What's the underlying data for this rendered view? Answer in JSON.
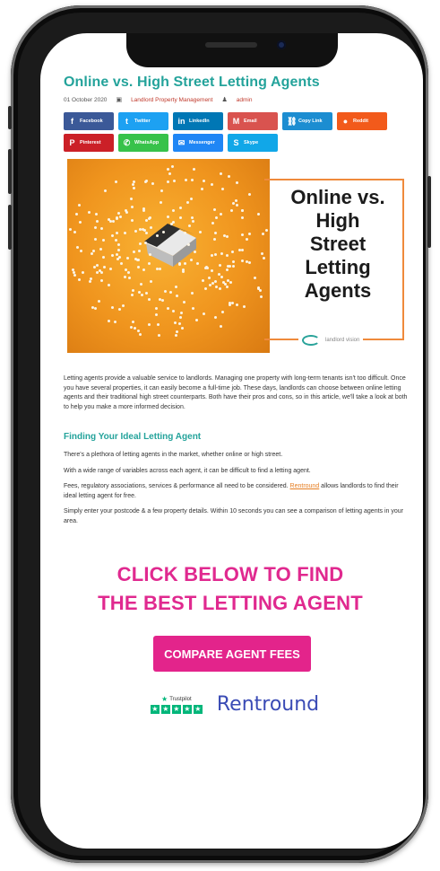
{
  "post": {
    "title": "Online vs. High Street Letting Agents",
    "date": "01 October 2020",
    "category": "Landlord Property Management",
    "author": "admin"
  },
  "share_buttons": [
    {
      "label": "Facebook",
      "glyph": "f",
      "color": "#3b5998"
    },
    {
      "label": "Twitter",
      "glyph": "t",
      "color": "#1da1f2"
    },
    {
      "label": "LinkedIn",
      "glyph": "in",
      "color": "#0077b5"
    },
    {
      "label": "Email",
      "glyph": "M",
      "color": "#d9534f"
    },
    {
      "label": "Copy Link",
      "glyph": "⛓",
      "color": "#1c8dd1"
    },
    {
      "label": "Reddit",
      "glyph": "●",
      "color": "#f25a1b"
    },
    {
      "label": "Pinterest",
      "glyph": "P",
      "color": "#cb2027"
    },
    {
      "label": "WhatsApp",
      "glyph": "✆",
      "color": "#37c24a"
    },
    {
      "label": "Messenger",
      "glyph": "✉",
      "color": "#1f86f5"
    },
    {
      "label": "Skype",
      "glyph": "S",
      "color": "#11a7e8"
    }
  ],
  "hero": {
    "lines": [
      "Online vs.",
      "High",
      "Street",
      "Letting",
      "Agents"
    ],
    "brand": "landlord vision"
  },
  "intro": "Letting agents provide a valuable service to landlords. Managing one property with long-term tenants isn't too difficult. Once you have several properties, it can easily become a full-time job. These days, landlords can choose between online letting agents and their traditional high street counterparts. Both have their pros and cons, so in this article, we'll take a look at both to help you make a more informed decision.",
  "section": {
    "heading": "Finding Your Ideal Letting Agent",
    "p1": "There's a plethora of letting agents in the market, whether online or high street.",
    "p2": "With a wide range of variables across each agent, it can be difficult to find a letting agent.",
    "p3_before": "Fees, regulatory associations, services & performance all need to be considered. ",
    "p3_link": "Rentround",
    "p3_after": " allows landlords to find their ideal letting agent for free.",
    "p4": "Simply enter your postcode & a few property details. Within 10 seconds you can see a comparison of letting agents in your area."
  },
  "cta": {
    "line1": "CLICK BELOW TO FIND",
    "line2": "THE BEST LETTING AGENT",
    "button": "COMPARE AGENT FEES"
  },
  "badges": {
    "trustpilot": "Trustpilot",
    "rentround": "Rentround"
  },
  "colors": {
    "teal": "#24a39b",
    "pink": "#e3248b",
    "orange": "#f0951e"
  }
}
